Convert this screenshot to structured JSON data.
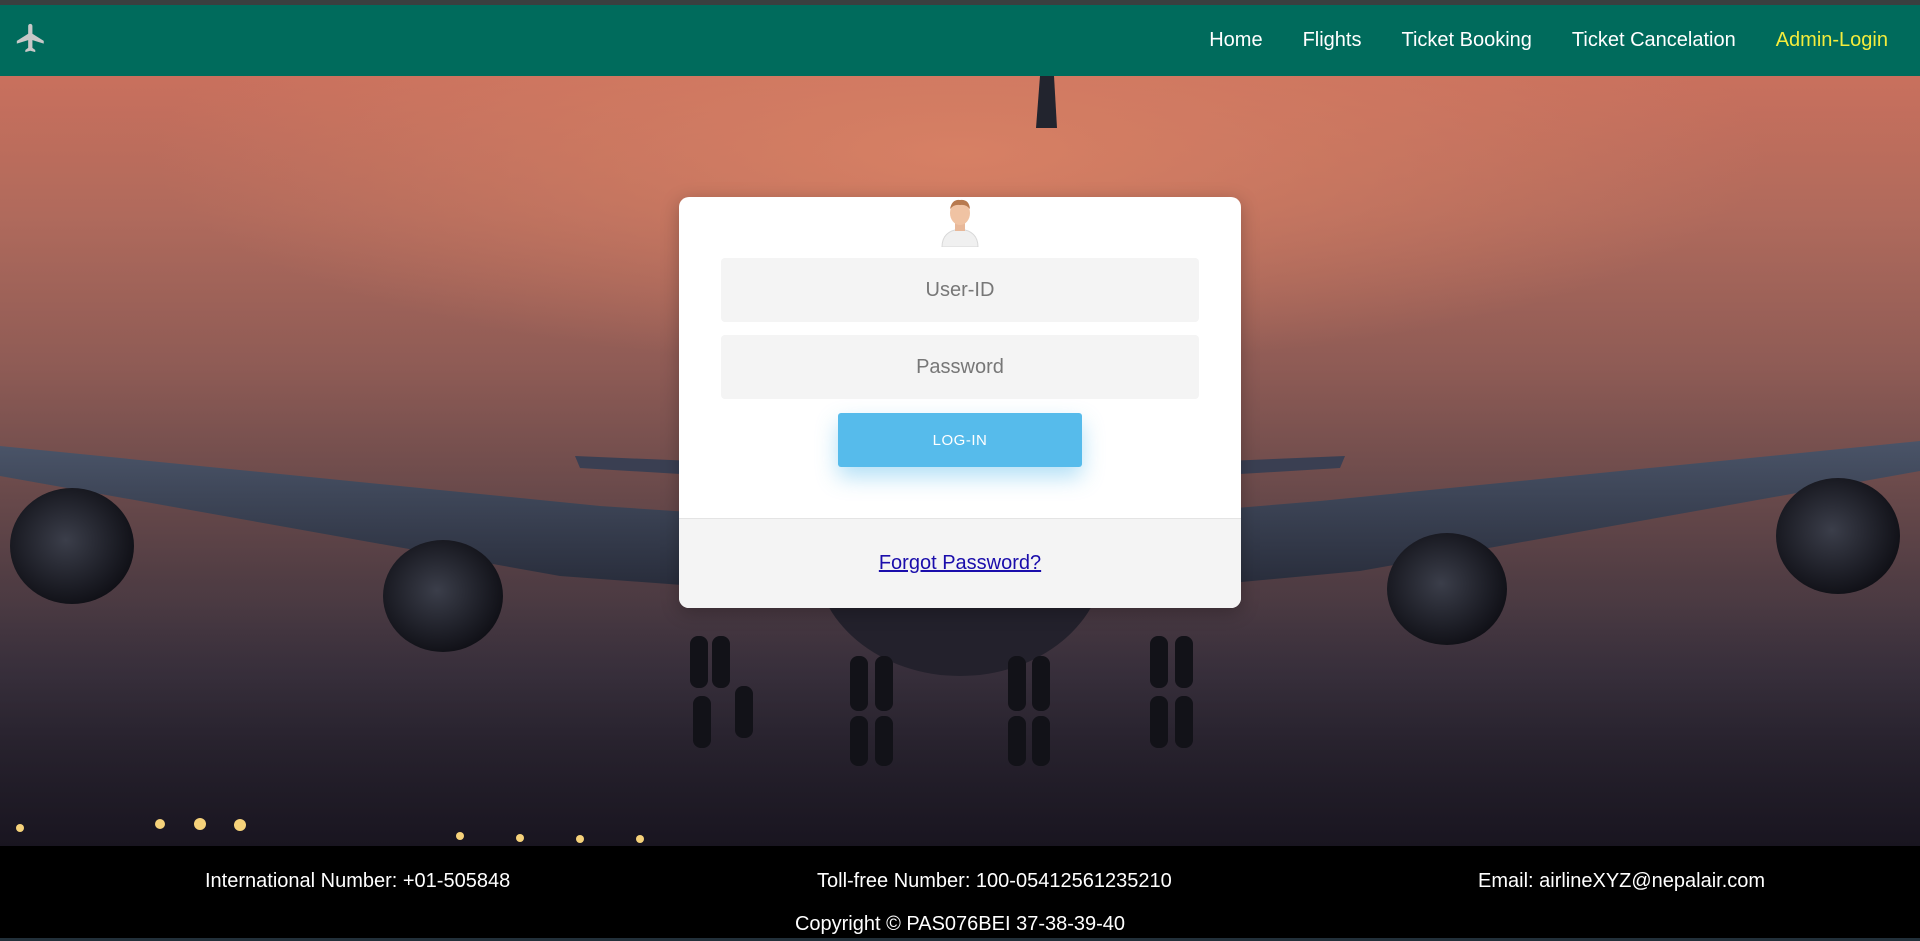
{
  "brand": {
    "icon": "airplane-icon",
    "color": "#c8c8c8"
  },
  "nav": {
    "background": "#006b5c",
    "items": [
      {
        "label": "Home",
        "active": false
      },
      {
        "label": "Flights",
        "active": false
      },
      {
        "label": "Ticket Booking",
        "active": false
      },
      {
        "label": "Ticket Cancelation",
        "active": false
      },
      {
        "label": "Admin-Login",
        "active": true,
        "color": "#f4ec3c"
      }
    ]
  },
  "login": {
    "avatar_icon": "user-avatar-icon",
    "user_placeholder": "User-ID",
    "password_placeholder": "Password",
    "submit_label": "LOG-IN",
    "submit_color": "#56bbeb",
    "forgot_label": "Forgot Password?"
  },
  "footer": {
    "international": "International Number: +01-505848",
    "tollfree": "Toll-free Number: 100-05412561235210",
    "email": "Email: airlineXYZ@nepalair.com",
    "copyright": "Copyright © PAS076BEI 37-38-39-40"
  }
}
